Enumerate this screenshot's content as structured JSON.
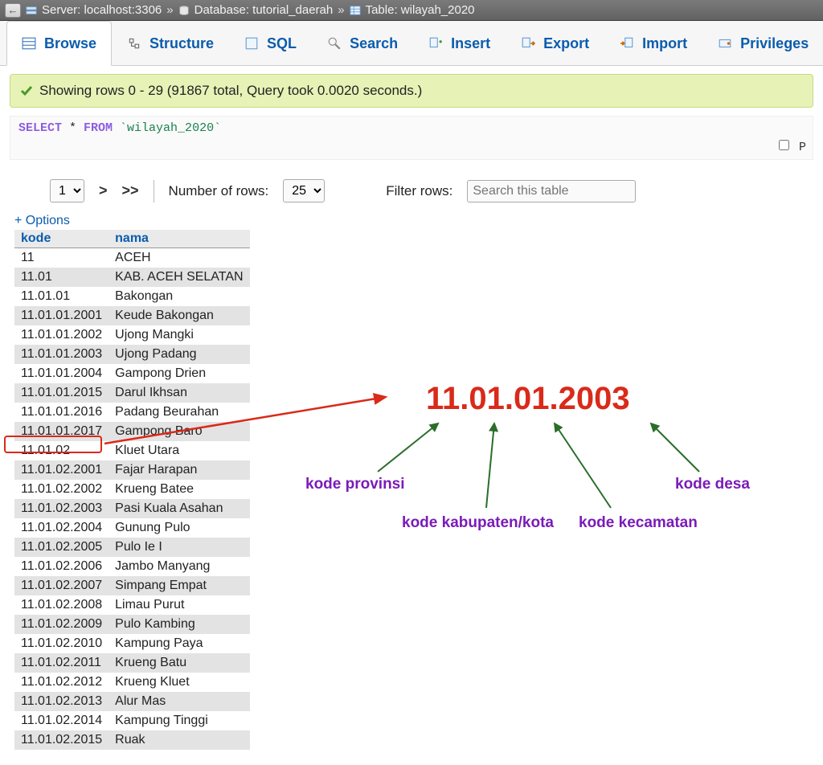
{
  "breadcrumb": {
    "server_label": "Server: localhost:3306",
    "db_label": "Database: tutorial_daerah",
    "table_label": "Table: wilayah_2020"
  },
  "tabs": {
    "browse": "Browse",
    "structure": "Structure",
    "sql": "SQL",
    "search": "Search",
    "insert": "Insert",
    "export": "Export",
    "import": "Import",
    "privileges": "Privileges"
  },
  "success": "Showing rows 0 - 29 (91867 total, Query took 0.0020 seconds.)",
  "sql": {
    "select": "SELECT",
    "star": " * ",
    "from": "FROM",
    "table": " `wilayah_2020`"
  },
  "checkbox_label": "P",
  "pager": {
    "page_value": "1",
    "next": ">",
    "last": ">>",
    "numrows_label": "Number of rows:",
    "numrows_value": "25",
    "filter_label": "Filter rows:",
    "filter_placeholder": "Search this table"
  },
  "options_label": "+ Options",
  "headers": {
    "kode": "kode",
    "nama": "nama"
  },
  "rows": [
    {
      "kode": "11",
      "nama": "ACEH"
    },
    {
      "kode": "11.01",
      "nama": "KAB. ACEH SELATAN"
    },
    {
      "kode": "11.01.01",
      "nama": "Bakongan"
    },
    {
      "kode": "11.01.01.2001",
      "nama": "Keude Bakongan"
    },
    {
      "kode": "11.01.01.2002",
      "nama": "Ujong Mangki"
    },
    {
      "kode": "11.01.01.2003",
      "nama": "Ujong Padang"
    },
    {
      "kode": "11.01.01.2004",
      "nama": "Gampong Drien"
    },
    {
      "kode": "11.01.01.2015",
      "nama": "Darul Ikhsan"
    },
    {
      "kode": "11.01.01.2016",
      "nama": "Padang Beurahan"
    },
    {
      "kode": "11.01.01.2017",
      "nama": "Gampong Baro"
    },
    {
      "kode": "11.01.02",
      "nama": "Kluet Utara"
    },
    {
      "kode": "11.01.02.2001",
      "nama": "Fajar Harapan"
    },
    {
      "kode": "11.01.02.2002",
      "nama": "Krueng Batee"
    },
    {
      "kode": "11.01.02.2003",
      "nama": "Pasi Kuala Asahan"
    },
    {
      "kode": "11.01.02.2004",
      "nama": "Gunung Pulo"
    },
    {
      "kode": "11.01.02.2005",
      "nama": "Pulo Ie I"
    },
    {
      "kode": "11.01.02.2006",
      "nama": "Jambo Manyang"
    },
    {
      "kode": "11.01.02.2007",
      "nama": "Simpang Empat"
    },
    {
      "kode": "11.01.02.2008",
      "nama": "Limau Purut"
    },
    {
      "kode": "11.01.02.2009",
      "nama": "Pulo Kambing"
    },
    {
      "kode": "11.01.02.2010",
      "nama": "Kampung Paya"
    },
    {
      "kode": "11.01.02.2011",
      "nama": "Krueng Batu"
    },
    {
      "kode": "11.01.02.2012",
      "nama": "Krueng Kluet"
    },
    {
      "kode": "11.01.02.2013",
      "nama": "Alur Mas"
    },
    {
      "kode": "11.01.02.2014",
      "nama": "Kampung Tinggi"
    },
    {
      "kode": "11.01.02.2015",
      "nama": "Ruak"
    }
  ],
  "annotation": {
    "code": "11.01.01.2003",
    "provinsi": "kode provinsi",
    "kabkota": "kode kabupaten/kota",
    "kecamatan": "kode kecamatan",
    "desa": "kode desa"
  }
}
